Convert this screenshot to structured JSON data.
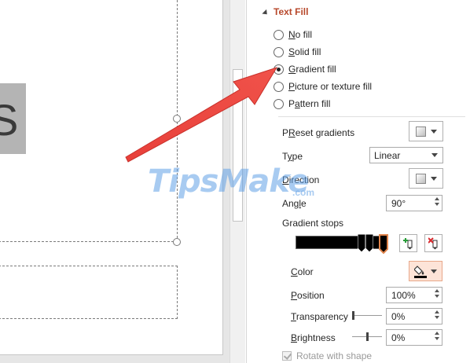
{
  "slide": {
    "shape_letter": "S"
  },
  "pane": {
    "section_title": "Text Fill",
    "fill_options": [
      {
        "key": "N",
        "rest": "o fill",
        "selected": false
      },
      {
        "key": "S",
        "rest": "olid fill",
        "selected": false
      },
      {
        "key": "G",
        "rest": "radient fill",
        "selected": true
      },
      {
        "key": "P",
        "rest": "icture or texture fill",
        "selected": false
      },
      {
        "key": "",
        "prefix": "P",
        "key2": "a",
        "rest": "ttern fill",
        "selected": false
      }
    ],
    "preset_gradients": {
      "label_key": "R",
      "label_pre": "P",
      "label_rest": "eset gradients"
    },
    "type": {
      "label_pre": "T",
      "label_key": "y",
      "label_rest": "pe",
      "value": "Linear"
    },
    "direction": {
      "label_key": "D",
      "label_rest": "irection"
    },
    "angle": {
      "label_pre": "Ang",
      "label_key": "l",
      "label_rest": "e",
      "value": "90°"
    },
    "gradient_stops": {
      "label": "Gradient stops"
    },
    "color": {
      "label_key": "C",
      "label_rest": "olor"
    },
    "position": {
      "label_key": "P",
      "label_rest": "osition",
      "value": "100%"
    },
    "transparency": {
      "label_key": "T",
      "label_rest": "ransparency",
      "value": "0%",
      "level": 0
    },
    "brightness": {
      "label_key": "B",
      "label_rest": "rightness",
      "value": "0%",
      "level": 0.5
    },
    "rotate_with_shape": {
      "label": "Rotate with shape",
      "checked": true
    }
  },
  "watermark": {
    "main": "TipsMake",
    "suffix": ".com"
  },
  "colors": {
    "accent": "#b7472a",
    "arrow": "#e8403a",
    "watermark": "#60a0e6"
  }
}
